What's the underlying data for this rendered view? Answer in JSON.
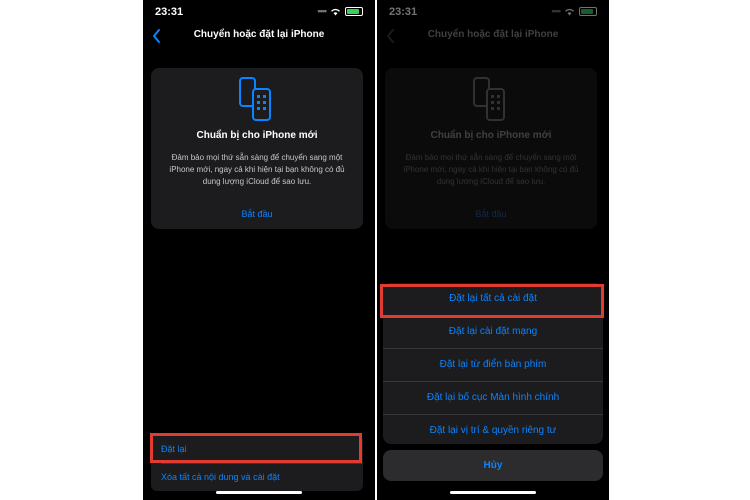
{
  "status": {
    "time": "23:31"
  },
  "navigation": {
    "title": "Chuyển hoặc đặt lại iPhone"
  },
  "prepare_card": {
    "icon": "two-phones-icon",
    "title": "Chuẩn bị cho iPhone mới",
    "description": "Đảm bảo mọi thứ sẵn sàng để chuyển sang một iPhone mới, ngay cả khi hiện tại bạn không có đủ dung lượng iCloud để sao lưu.",
    "action": "Bắt đầu"
  },
  "reset_list": {
    "reset": "Đặt lại",
    "erase_all": "Xóa tất cả nội dung và cài đặt"
  },
  "action_sheet": {
    "items": [
      "Đặt lại tất cả cài đặt",
      "Đặt lại cài đặt mạng",
      "Đặt lại từ điển bàn phím",
      "Đặt lại bố cục Màn hình chính",
      "Đặt lại vị trí & quyền riêng tư"
    ],
    "cancel": "Hủy"
  },
  "colors": {
    "accent": "#0a84ff",
    "highlight": "#e23b2f",
    "background": "#000000",
    "card": "#1c1c1e"
  }
}
